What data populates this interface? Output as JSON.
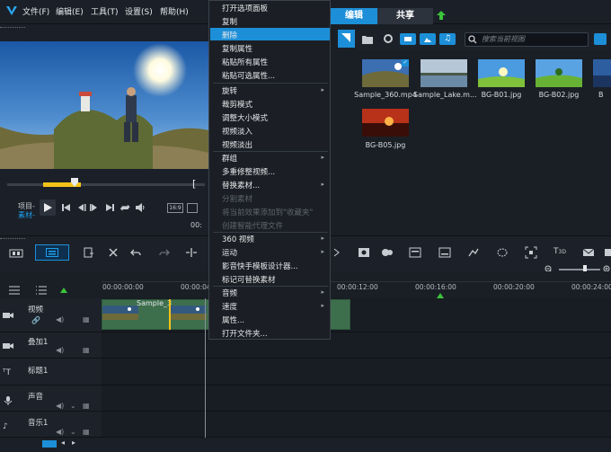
{
  "menubar": {
    "file": "文件(F)",
    "edit": "编辑(E)",
    "tools": "工具(T)",
    "settings": "设置(S)",
    "help": "帮助(H)"
  },
  "tabs": {
    "edit": "编辑",
    "share": "共享"
  },
  "player": {
    "project_label": "项目-",
    "clip_label": "素材-",
    "timecode_partial": "00:"
  },
  "library": {
    "search_placeholder": "搜索当前视图",
    "items": [
      "Sample_360.mp4",
      "Sample_Lake.m...",
      "BG-B01.jpg",
      "BG-B02.jpg",
      "BG-B05.jpg"
    ],
    "partial_item": "B"
  },
  "timeline": {
    "ticks": [
      "00:00:00:00",
      "00:00:04",
      "00:00:12:00",
      "00:00:16:00",
      "00:00:20:00",
      "00:00:24:00"
    ],
    "tracks": [
      {
        "name": "视频"
      },
      {
        "name": "叠加1"
      },
      {
        "name": "标题1"
      },
      {
        "name": "声音"
      },
      {
        "name": "音乐1"
      }
    ],
    "clip_label": "Sample_3"
  },
  "context_menu": {
    "items": [
      {
        "label": "打开选项面板",
        "disabled": false
      },
      {
        "label": "复制",
        "disabled": false
      },
      {
        "label": "删除",
        "disabled": false,
        "highlighted": true
      },
      {
        "label": "复制属性",
        "disabled": false
      },
      {
        "label": "粘贴所有属性",
        "disabled": false
      },
      {
        "label": "粘贴可选属性...",
        "disabled": false
      },
      {
        "label": "旋转",
        "disabled": false,
        "submenu": true
      },
      {
        "label": "裁剪模式",
        "disabled": false
      },
      {
        "label": "调整大小模式",
        "disabled": false
      },
      {
        "label": "视频淡入",
        "disabled": false
      },
      {
        "label": "视频淡出",
        "disabled": false
      },
      {
        "label": "群组",
        "disabled": false,
        "submenu": true
      },
      {
        "label": "多重修整视频...",
        "disabled": false
      },
      {
        "label": "替换素材...",
        "disabled": false,
        "submenu": true
      },
      {
        "label": "分割素材",
        "disabled": true
      },
      {
        "label": "将当前效果添加到\"收藏夹\"",
        "disabled": true
      },
      {
        "label": "创建智能代理文件",
        "disabled": true
      },
      {
        "label": "360 视频",
        "disabled": false,
        "submenu": true
      },
      {
        "label": "运动",
        "disabled": false,
        "submenu": true
      },
      {
        "label": "影音快手模板设计器...",
        "disabled": false
      },
      {
        "label": "标记可替换素材",
        "disabled": false
      },
      {
        "label": "音频",
        "disabled": false,
        "submenu": true
      },
      {
        "label": "速度",
        "disabled": false,
        "submenu": true
      },
      {
        "label": "属性...",
        "disabled": false
      },
      {
        "label": "打开文件夹...",
        "disabled": false
      }
    ]
  },
  "colors": {
    "accent": "#1d8fd8",
    "clip_green": "#3e6f4d",
    "trim_yellow": "#f3c318"
  }
}
